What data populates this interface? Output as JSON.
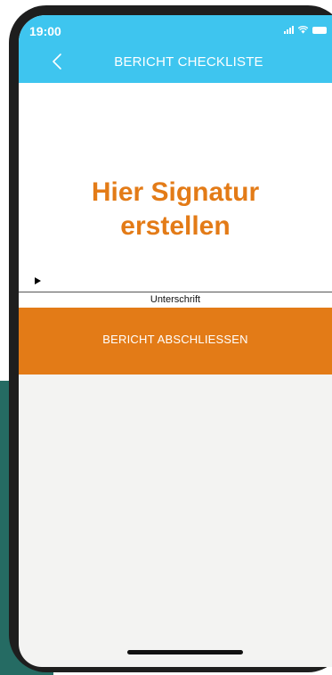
{
  "status_bar": {
    "time": "19:00"
  },
  "header": {
    "title": "BERICHT CHECKLISTE",
    "back_icon": "chevron-left-icon"
  },
  "signature": {
    "prompt": "Hier Signatur\nerstellen",
    "caption": "Unterschrift"
  },
  "actions": {
    "finish_label": "BERICHT ABSCHLIESSEN"
  },
  "colors": {
    "header": "#3ec5ef",
    "accent": "#e37b17",
    "background": "#f3f3f2",
    "backdrop": "#256b63"
  }
}
